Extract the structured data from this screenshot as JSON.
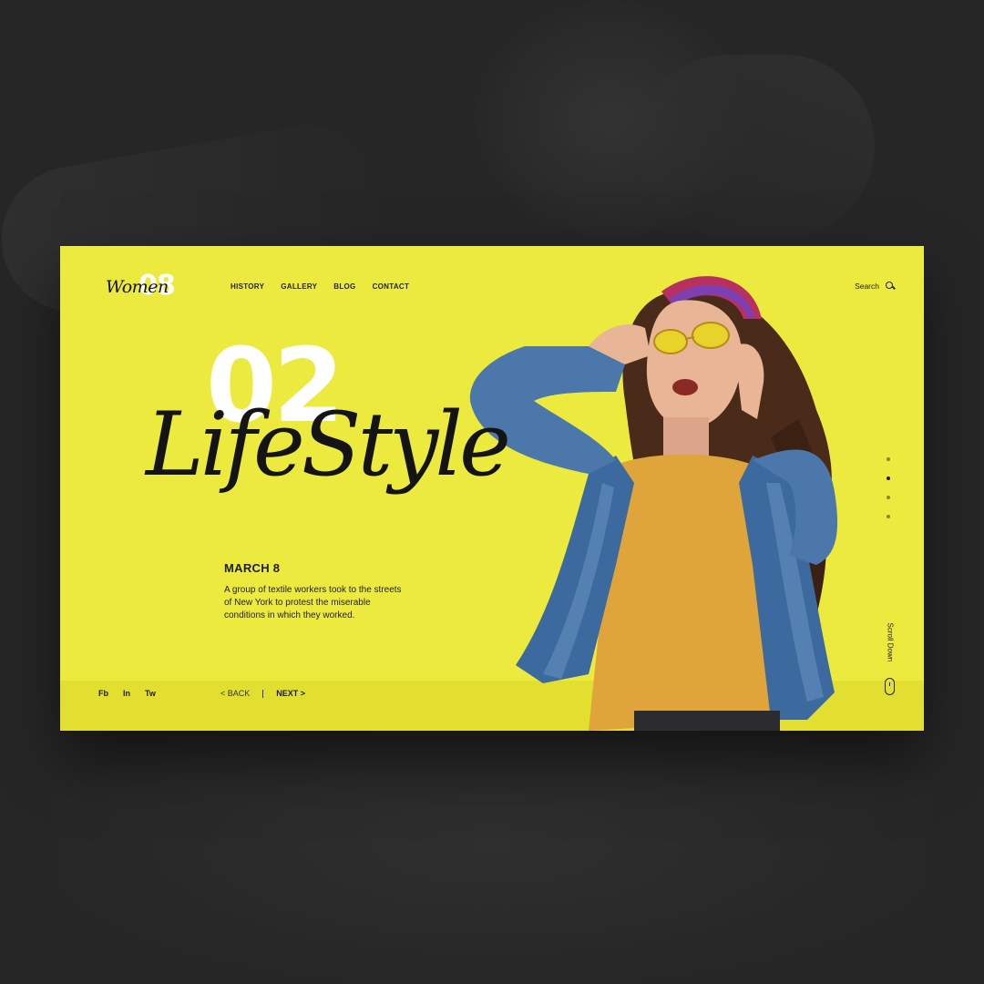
{
  "brand": {
    "word": "Women",
    "number": "08"
  },
  "nav": {
    "items": [
      "HISTORY",
      "GALLERY",
      "BLOG",
      "CONTACT"
    ]
  },
  "search": {
    "label": "Search",
    "icon": "search-icon"
  },
  "hero": {
    "number": "02",
    "title": "LifeStyle",
    "date": "MARCH 8",
    "description": "A group of textile workers took to the streets of New York to protest the miserable conditions in which they worked."
  },
  "social": [
    "Fb",
    "In",
    "Tw"
  ],
  "pager": {
    "back": "< BACK",
    "next": "NEXT >"
  },
  "slider": {
    "count": 4,
    "active_index": 1
  },
  "scroll": {
    "label": "Scroll Down",
    "icon": "mouse-icon"
  },
  "colors": {
    "accent": "#ecea3f",
    "background": "#262626",
    "text": "#141414"
  }
}
